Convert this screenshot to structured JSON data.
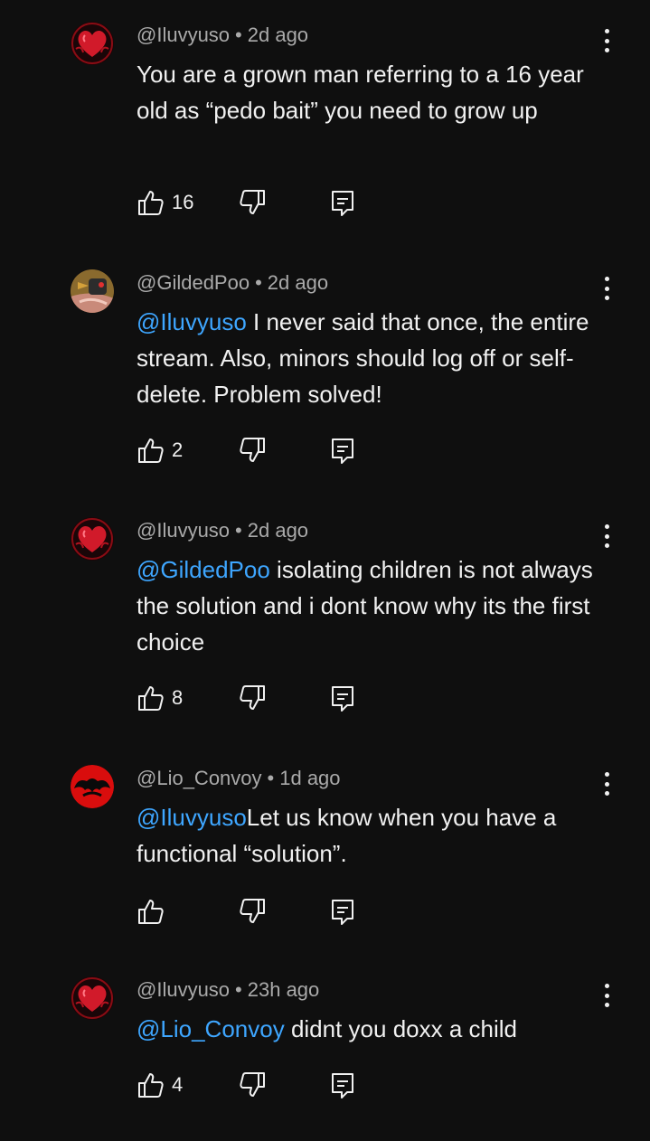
{
  "comments": [
    {
      "handle": "@Iluvyuso",
      "separator": "•",
      "time": "2d ago",
      "mention": "",
      "text": "You are a grown man referring to a 16 year old as “pedo bait” you need to grow up",
      "likes": "16",
      "avatar": "heart-avatar"
    },
    {
      "handle": "@GildedPoo",
      "separator": "•",
      "time": "2d ago",
      "mention": "@Iluvyuso",
      "text": " I never said that once, the entire stream. Also, minors should log off or self-delete. Problem solved!",
      "likes": "2",
      "avatar": "character-avatar"
    },
    {
      "handle": "@Iluvyuso",
      "separator": "•",
      "time": "2d ago",
      "mention": "@GildedPoo",
      "text": " isolating children is not always the solution and i dont know why its the first choice",
      "likes": "8",
      "avatar": "heart-avatar"
    },
    {
      "handle": "@Lio_Convoy",
      "separator": "•",
      "time": "1d ago",
      "mention": "@Iluvyuso",
      "text": "Let us know when you have a functional “solution”.",
      "likes": "",
      "avatar": "thundercats-avatar"
    },
    {
      "handle": "@Iluvyuso",
      "separator": "•",
      "time": "23h ago",
      "mention": "@Lio_Convoy",
      "text": " didnt you doxx a child",
      "likes": "4",
      "avatar": "heart-avatar"
    }
  ],
  "icons": {
    "like": "thumb-up-icon",
    "dislike": "thumb-down-icon",
    "reply": "reply-icon",
    "more": "more-vertical-icon"
  },
  "colors": {
    "background": "#0f0f0f",
    "text": "#f1f1f1",
    "meta": "#aaaaaa",
    "mention": "#3ea6ff"
  }
}
